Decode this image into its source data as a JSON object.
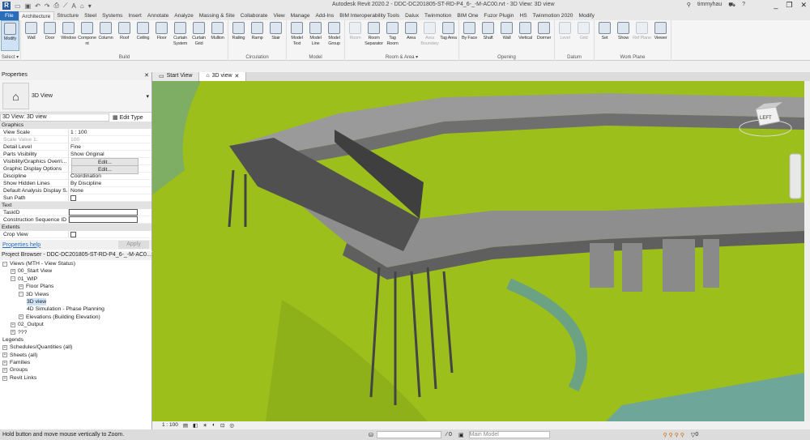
{
  "app": {
    "title": "Autodesk Revit 2020.2 - DDC-DC201805-ST-RD-P4_6-_-M-AC00.rvt - 3D View: 3D view",
    "user": "timmyhau"
  },
  "menu_tabs": [
    "File",
    "Architecture",
    "Structure",
    "Steel",
    "Systems",
    "Insert",
    "Annotate",
    "Analyze",
    "Massing & Site",
    "Collaborate",
    "View",
    "Manage",
    "Add-Ins",
    "BIM Interoperability Tools",
    "Dalux",
    "Twinmotion",
    "BIM One",
    "Fuzor Plugin",
    "HS",
    "Twinmotion 2020",
    "Modify"
  ],
  "ribbon": {
    "select": {
      "label": "Select ▾",
      "buttons": [
        "Modify"
      ]
    },
    "build": {
      "label": "Build",
      "buttons": [
        "Wall",
        "Door",
        "Window",
        "Component",
        "Column",
        "Roof",
        "Ceiling",
        "Floor",
        "Curtain System",
        "Curtain Grid",
        "Mullion"
      ]
    },
    "circulation": {
      "label": "Circulation",
      "buttons": [
        "Railing",
        "Ramp",
        "Stair"
      ]
    },
    "model": {
      "label": "Model",
      "buttons": [
        "Model Text",
        "Model Line",
        "Model Group"
      ]
    },
    "room": {
      "label": "Room & Area ▾",
      "buttons": [
        "Room",
        "Room Separator",
        "Tag Room",
        "Area",
        "Area Boundary",
        "Tag Area"
      ]
    },
    "opening": {
      "label": "Opening",
      "buttons": [
        "By Face",
        "Shaft",
        "Wall",
        "Vertical",
        "Dormer"
      ]
    },
    "datum": {
      "label": "Datum",
      "buttons": [
        "Level",
        "Grid"
      ]
    },
    "workplane": {
      "label": "Work Plane",
      "buttons": [
        "Set",
        "Show",
        "Ref Plane",
        "Viewer"
      ]
    }
  },
  "view_tabs": [
    "Start View",
    "3D view"
  ],
  "properties": {
    "title": "Properties",
    "type": "3D View",
    "filter": "3D View: 3D view",
    "edit_type": "Edit Type",
    "groups": [
      {
        "name": "Graphics",
        "rows": [
          [
            "View Scale",
            "1 : 100"
          ],
          [
            "Scale Value    1:",
            "100"
          ],
          [
            "Detail Level",
            "Fine"
          ],
          [
            "Parts Visibility",
            "Show Original"
          ],
          [
            "Visibility/Graphics Overri...",
            "Edit..."
          ],
          [
            "Graphic Display Options",
            "Edit..."
          ],
          [
            "Discipline",
            "Coordination"
          ],
          [
            "Show Hidden Lines",
            "By Discipline"
          ],
          [
            "Default Analysis Display S...",
            "None"
          ],
          [
            "Sun Path",
            ""
          ]
        ]
      },
      {
        "name": "Text",
        "rows": [
          [
            "TaskID",
            ""
          ],
          [
            "Construction Sequence ID",
            ""
          ]
        ]
      },
      {
        "name": "Extents",
        "rows": [
          [
            "Crop View",
            ""
          ]
        ]
      }
    ],
    "help": "Properties help",
    "apply": "Apply"
  },
  "browser": {
    "title": "Project Browser - DDC-DC201805-ST-RD-P4_6-_-M-AC0...",
    "items": [
      {
        "label": "Views (MTH - View Status)",
        "level": 0,
        "toggle": "−"
      },
      {
        "label": "00_Start View",
        "level": 1,
        "toggle": "+"
      },
      {
        "label": "01_WIP",
        "level": 1,
        "toggle": "−"
      },
      {
        "label": "Floor Plans",
        "level": 2,
        "toggle": "+"
      },
      {
        "label": "3D Views",
        "level": 2,
        "toggle": "−"
      },
      {
        "label": "3D view",
        "level": 3,
        "toggle": "",
        "selected": true
      },
      {
        "label": "4D Simulation - Phase Planning",
        "level": 3,
        "toggle": ""
      },
      {
        "label": "Elevations (Building Elevation)",
        "level": 2,
        "toggle": "+"
      },
      {
        "label": "02_Output",
        "level": 1,
        "toggle": "+"
      },
      {
        "label": "???",
        "level": 1,
        "toggle": "+"
      },
      {
        "label": "Legends",
        "level": 0,
        "toggle": ""
      },
      {
        "label": "Schedules/Quantities (all)",
        "level": 0,
        "toggle": "+"
      },
      {
        "label": "Sheets (all)",
        "level": 0,
        "toggle": "+"
      },
      {
        "label": "Families",
        "level": 0,
        "toggle": "+"
      },
      {
        "label": "Groups",
        "level": 0,
        "toggle": "+"
      },
      {
        "label": "Revit Links",
        "level": 0,
        "toggle": "+"
      }
    ]
  },
  "viewcube": "LEFT",
  "view_scale": "1 : 100",
  "status": {
    "message": "Hold button and move mouse vertically to Zoom.",
    "selection_count": "0",
    "model": "Main Model",
    "filter_count": "0"
  }
}
